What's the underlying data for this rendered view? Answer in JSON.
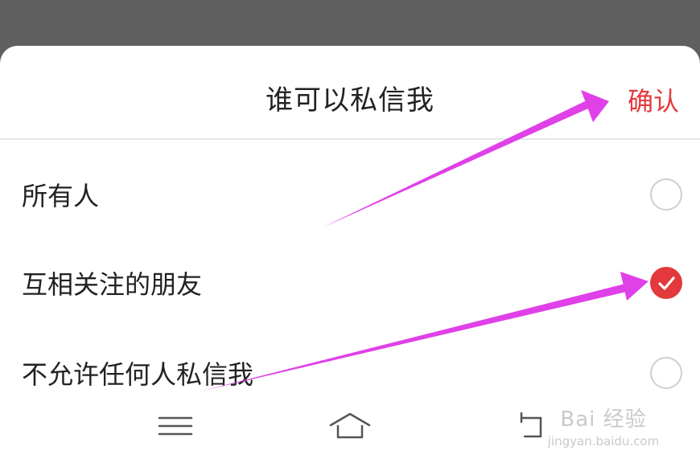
{
  "dialog": {
    "title": "谁可以私信我",
    "confirm_label": "确认"
  },
  "options": [
    {
      "label": "所有人",
      "selected": false
    },
    {
      "label": "互相关注的朋友",
      "selected": true
    },
    {
      "label": "不允许任何人私信我",
      "selected": false
    }
  ],
  "navbar": {
    "icons": [
      "menu-icon",
      "home-icon",
      "back-icon"
    ]
  },
  "watermark": {
    "logo_text": "Bai 经验",
    "url": "jingyan.baidu.com"
  },
  "colors": {
    "accent": "#e3393c",
    "annotation_arrow": "#e040e8",
    "backdrop": "#5f5f5f"
  }
}
